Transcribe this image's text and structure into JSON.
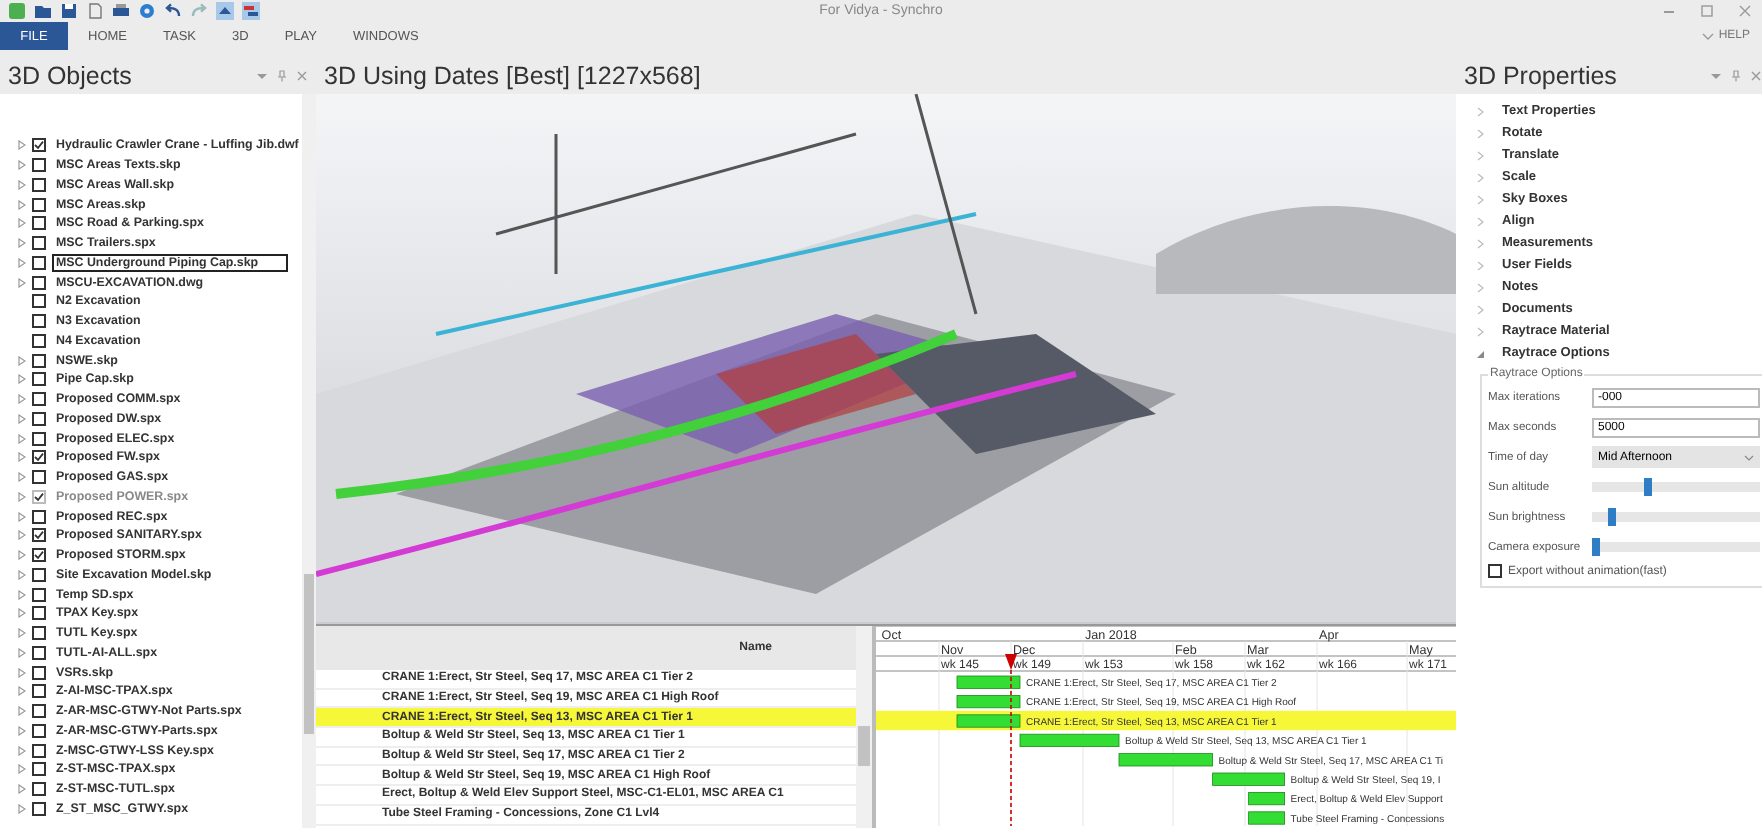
{
  "window": {
    "title": "For Vidya - Synchro"
  },
  "ribbon": {
    "tabs": [
      {
        "label": "FILE",
        "selected": true
      },
      {
        "label": "HOME",
        "selected": false
      },
      {
        "label": "TASK",
        "selected": false
      },
      {
        "label": "3D",
        "selected": false
      },
      {
        "label": "PLAY",
        "selected": false
      },
      {
        "label": "WINDOWS",
        "selected": false
      }
    ],
    "help": "HELP"
  },
  "objects_panel": {
    "title": "3D Objects",
    "items": [
      {
        "label": "Hydraulic Crawler Crane - Luffing Jib.dwf",
        "checked": true,
        "disabled": false,
        "expandable": true,
        "selected": false
      },
      {
        "label": "MSC Areas Texts.skp",
        "checked": false,
        "disabled": false,
        "expandable": true,
        "selected": false
      },
      {
        "label": "MSC Areas Wall.skp",
        "checked": false,
        "disabled": false,
        "expandable": true,
        "selected": false
      },
      {
        "label": "MSC Areas.skp",
        "checked": false,
        "disabled": false,
        "expandable": true,
        "selected": false
      },
      {
        "label": "MSC Road & Parking.spx",
        "checked": false,
        "disabled": false,
        "expandable": true,
        "selected": false
      },
      {
        "label": "MSC Trailers.spx",
        "checked": false,
        "disabled": false,
        "expandable": true,
        "selected": false
      },
      {
        "label": "MSC Underground Piping Cap.skp",
        "checked": false,
        "disabled": false,
        "expandable": true,
        "selected": true
      },
      {
        "label": "MSCU-EXCAVATION.dwg",
        "checked": false,
        "disabled": false,
        "expandable": true,
        "selected": false
      },
      {
        "label": "N2 Excavation",
        "checked": false,
        "disabled": false,
        "expandable": false,
        "selected": false
      },
      {
        "label": "N3 Excavation",
        "checked": false,
        "disabled": false,
        "expandable": false,
        "selected": false
      },
      {
        "label": "N4 Excavation",
        "checked": false,
        "disabled": false,
        "expandable": false,
        "selected": false
      },
      {
        "label": "NSWE.skp",
        "checked": false,
        "disabled": false,
        "expandable": true,
        "selected": false
      },
      {
        "label": "Pipe Cap.skp",
        "checked": false,
        "disabled": false,
        "expandable": true,
        "selected": false
      },
      {
        "label": "Proposed COMM.spx",
        "checked": false,
        "disabled": false,
        "expandable": true,
        "selected": false
      },
      {
        "label": "Proposed DW.spx",
        "checked": false,
        "disabled": false,
        "expandable": true,
        "selected": false
      },
      {
        "label": "Proposed ELEC.spx",
        "checked": false,
        "disabled": false,
        "expandable": true,
        "selected": false
      },
      {
        "label": "Proposed FW.spx",
        "checked": true,
        "disabled": false,
        "expandable": true,
        "selected": false
      },
      {
        "label": "Proposed GAS.spx",
        "checked": false,
        "disabled": false,
        "expandable": true,
        "selected": false
      },
      {
        "label": "Proposed POWER.spx",
        "checked": true,
        "disabled": true,
        "expandable": true,
        "selected": false
      },
      {
        "label": "Proposed REC.spx",
        "checked": false,
        "disabled": false,
        "expandable": true,
        "selected": false
      },
      {
        "label": "Proposed SANITARY.spx",
        "checked": true,
        "disabled": false,
        "expandable": true,
        "selected": false
      },
      {
        "label": "Proposed STORM.spx",
        "checked": true,
        "disabled": false,
        "expandable": true,
        "selected": false
      },
      {
        "label": "Site Excavation Model.skp",
        "checked": false,
        "disabled": false,
        "expandable": true,
        "selected": false
      },
      {
        "label": "Temp SD.spx",
        "checked": false,
        "disabled": false,
        "expandable": true,
        "selected": false
      },
      {
        "label": "TPAX Key.spx",
        "checked": false,
        "disabled": false,
        "expandable": true,
        "selected": false
      },
      {
        "label": "TUTL Key.spx",
        "checked": false,
        "disabled": false,
        "expandable": true,
        "selected": false
      },
      {
        "label": "TUTL-AI-ALL.spx",
        "checked": false,
        "disabled": false,
        "expandable": true,
        "selected": false
      },
      {
        "label": "VSRs.skp",
        "checked": false,
        "disabled": false,
        "expandable": true,
        "selected": false
      },
      {
        "label": "Z-AI-MSC-TPAX.spx",
        "checked": false,
        "disabled": false,
        "expandable": true,
        "selected": false
      },
      {
        "label": "Z-AR-MSC-GTWY-Not Parts.spx",
        "checked": false,
        "disabled": false,
        "expandable": true,
        "selected": false
      },
      {
        "label": "Z-AR-MSC-GTWY-Parts.spx",
        "checked": false,
        "disabled": false,
        "expandable": true,
        "selected": false
      },
      {
        "label": "Z-MSC-GTWY-LSS Key.spx",
        "checked": false,
        "disabled": false,
        "expandable": true,
        "selected": false
      },
      {
        "label": "Z-ST-MSC-TPAX.spx",
        "checked": false,
        "disabled": false,
        "expandable": true,
        "selected": false
      },
      {
        "label": "Z-ST-MSC-TUTL.spx",
        "checked": false,
        "disabled": false,
        "expandable": true,
        "selected": false
      },
      {
        "label": "Z_ST_MSC_GTWY.spx",
        "checked": false,
        "disabled": false,
        "expandable": true,
        "selected": false
      }
    ]
  },
  "viewport": {
    "title": "3D Using Dates [Best] [1227x568]"
  },
  "task_table": {
    "column": "Name",
    "rows": [
      {
        "name": "CRANE 1:Erect, Str Steel, Seq 17,  MSC AREA C1 Tier 2",
        "selected": false
      },
      {
        "name": "CRANE 1:Erect, Str Steel, Seq 19,  MSC AREA C1 High Roof",
        "selected": false
      },
      {
        "name": "CRANE 1:Erect, Str Steel, Seq 13,  MSC AREA C1 Tier 1",
        "selected": true
      },
      {
        "name": "Boltup & Weld Str Steel, Seq 13, MSC AREA C1 Tier 1",
        "selected": false
      },
      {
        "name": "Boltup & Weld Str Steel, Seq 17, MSC AREA C1 Tier 2",
        "selected": false
      },
      {
        "name": "Boltup & Weld Str Steel, Seq 19, MSC AREA C1 High Roof",
        "selected": false
      },
      {
        "name": "Erect, Boltup & Weld Elev Support Steel, MSC-C1-EL01, MSC AREA C1",
        "selected": false
      },
      {
        "name": "Tube Steel Framing - Concessions, Zone C1 Lvl4",
        "selected": false
      }
    ]
  },
  "gantt": {
    "quarters": [
      "Oct",
      "Jan 2018",
      "Apr"
    ],
    "months": [
      "Nov",
      "Dec",
      "Feb",
      "Mar",
      "May"
    ],
    "weeks": [
      "wk 145",
      "wk 149",
      "wk 153",
      "wk 158",
      "wk 162",
      "wk 166",
      "wk 171"
    ],
    "bars": [
      {
        "label": "CRANE 1:Erect, Str Steel, Seq 17,  MSC AREA C1 Tier 2",
        "selected": false
      },
      {
        "label": "CRANE 1:Erect, Str Steel, Seq 19,  MSC AREA C1 High Roof",
        "selected": false
      },
      {
        "label": "CRANE 1:Erect, Str Steel, Seq 13,  MSC AREA C1 Tier 1",
        "selected": true
      },
      {
        "label": "Boltup & Weld Str Steel, Seq 13, MSC AREA C1 Tier 1",
        "selected": false
      },
      {
        "label": "Boltup & Weld Str Steel, Seq 17, MSC AREA C1 Ti",
        "selected": false
      },
      {
        "label": "Boltup & Weld Str Steel, Seq 19, I",
        "selected": false
      },
      {
        "label": "Erect, Boltup & Weld Elev Support",
        "selected": false
      },
      {
        "label": "Tube Steel Framing - Concessions",
        "selected": false
      }
    ]
  },
  "properties_panel": {
    "title": "3D Properties",
    "sections": [
      {
        "label": "Text Properties",
        "expanded": false
      },
      {
        "label": "Rotate",
        "expanded": false
      },
      {
        "label": "Translate",
        "expanded": false
      },
      {
        "label": "Scale",
        "expanded": false
      },
      {
        "label": "Sky Boxes",
        "expanded": false
      },
      {
        "label": "Align",
        "expanded": false
      },
      {
        "label": "Measurements",
        "expanded": false
      },
      {
        "label": "User Fields",
        "expanded": false
      },
      {
        "label": "Notes",
        "expanded": false
      },
      {
        "label": "Documents",
        "expanded": false
      },
      {
        "label": "Raytrace Material",
        "expanded": false
      },
      {
        "label": "Raytrace Options",
        "expanded": true
      }
    ],
    "group": {
      "title": "Raytrace Options",
      "fields": [
        {
          "kind": "input",
          "label": "Max iterations",
          "value": "-000"
        },
        {
          "kind": "input",
          "label": "Max seconds",
          "value": "5000"
        },
        {
          "kind": "select",
          "label": "Time of day",
          "value": "Mid Afternoon"
        },
        {
          "kind": "slider",
          "label": "Sun altitude",
          "level": 0.33
        },
        {
          "kind": "slider",
          "label": "Sun brightness",
          "level": 0.12
        },
        {
          "kind": "slider",
          "label": "Camera exposure",
          "level": 0.02
        },
        {
          "kind": "checkbox",
          "label": "Export without animation(fast)",
          "checked": false
        }
      ]
    }
  }
}
